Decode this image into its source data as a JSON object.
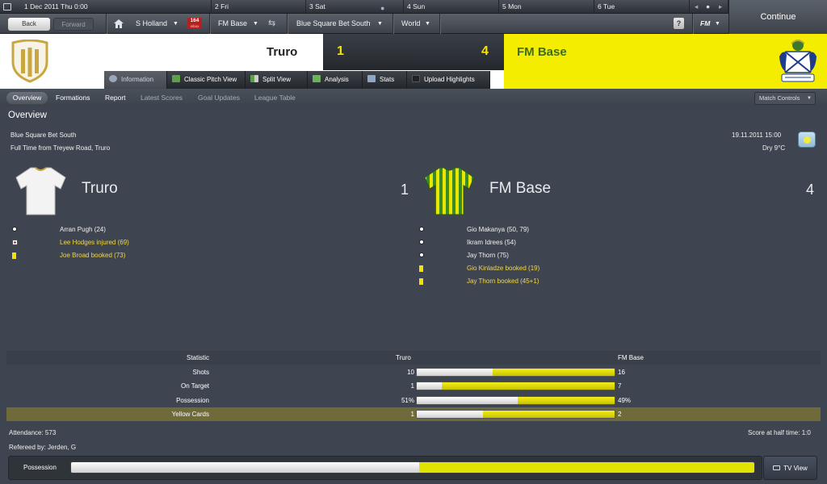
{
  "calendar": {
    "current_date": "1 Dec 2011",
    "current_time": "Thu 0:00",
    "days": [
      "2 Fri",
      "3 Sat",
      "4 Sun",
      "5 Mon",
      "6 Tue"
    ]
  },
  "nav": {
    "back": "Back",
    "forward": "Forward",
    "manager": "S Holland",
    "inbox_count": "164",
    "inbox_sub": "inbox",
    "club": "FM Base",
    "league": "Blue Square Bet South",
    "world": "World",
    "help": "?",
    "fm": "FM",
    "continue": "Continue"
  },
  "match": {
    "home_team": "Truro",
    "away_team": "FM Base",
    "home_score": "1",
    "away_score": "4"
  },
  "tabs": [
    {
      "label": "Information",
      "icon": "info-icon"
    },
    {
      "label": "Classic Pitch View",
      "icon": "pitch-icon"
    },
    {
      "label": "Split View",
      "icon": "split-view-icon"
    },
    {
      "label": "Analysis",
      "icon": "analysis-icon"
    },
    {
      "label": "Stats",
      "icon": "stats-icon"
    },
    {
      "label": "Upload Highlights",
      "icon": "camera-icon"
    }
  ],
  "subnav": {
    "items": [
      "Overview",
      "Formations",
      "Report",
      "Latest Scores",
      "Goal Updates",
      "League Table"
    ],
    "match_controls": "Match Controls"
  },
  "overview": {
    "title": "Overview",
    "competition": "Blue Square Bet South",
    "venue": "Full Time from Treyew Road, Truro",
    "date": "19.11.2011 15:00",
    "weather": "Dry 9°C"
  },
  "home_events": [
    {
      "type": "goal",
      "text": "Arran Pugh (24)"
    },
    {
      "type": "injury",
      "text": "Lee Hodges injured (69)"
    },
    {
      "type": "booking",
      "text": "Joe Broad booked (73)"
    }
  ],
  "away_events": [
    {
      "type": "goal",
      "text": "Gio Makanya (50, 79)"
    },
    {
      "type": "goal",
      "text": "Ikram Idrees (54)"
    },
    {
      "type": "goal",
      "text": "Jay Thorn (75)"
    },
    {
      "type": "booking",
      "text": "Gio Kinladze booked (19)"
    },
    {
      "type": "booking",
      "text": "Jay Thorn booked (45+1)"
    }
  ],
  "stats": {
    "header": {
      "label": "Statistic",
      "home": "Truro",
      "away": "FM Base"
    },
    "rows": [
      {
        "label": "Shots",
        "home": "10",
        "away": "16",
        "home_frac": 0.385
      },
      {
        "label": "On Target",
        "home": "1",
        "away": "7",
        "home_frac": 0.125
      },
      {
        "label": "Possession",
        "home": "51%",
        "away": "49%",
        "home_frac": 0.51
      },
      {
        "label": "Yellow Cards",
        "home": "1",
        "away": "2",
        "home_frac": 0.333
      }
    ]
  },
  "footer": {
    "attendance": "Attendance: 573",
    "referee": "Refereed by: Jerden, G",
    "halftime": "Score at half time: 1:0",
    "possession_label": "Possession",
    "possession_home_frac": 0.51,
    "tv_view": "TV View"
  },
  "colors": {
    "away_yellow": "#f4ed00",
    "score_yellow": "#f3e600",
    "event_yellow": "#f0d84a"
  }
}
